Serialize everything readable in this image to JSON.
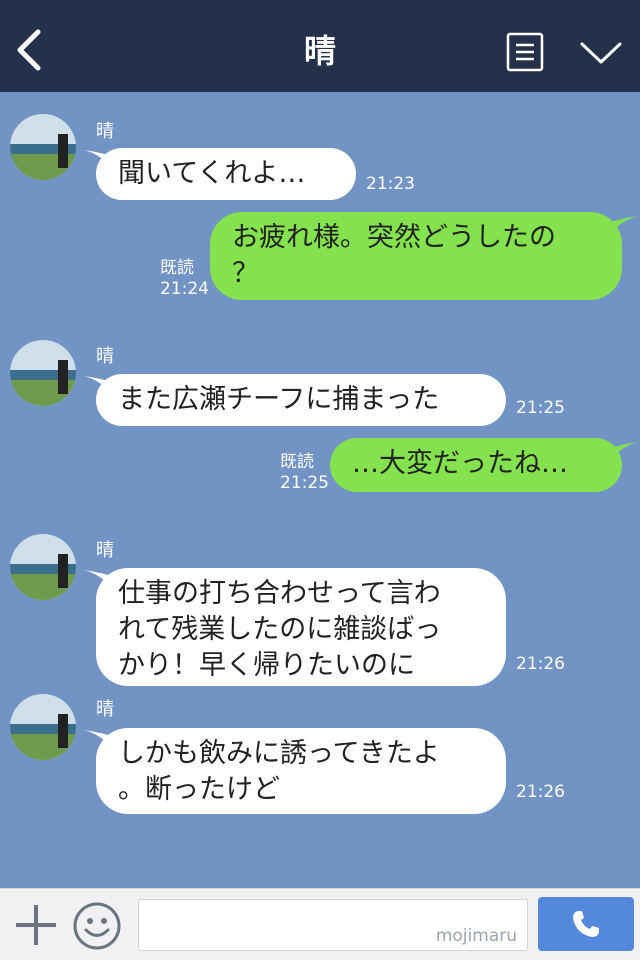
{
  "header": {
    "title": "晴",
    "icons": {
      "back": "chevron-left-icon",
      "menu": "list-icon",
      "collapse": "chevron-down-icon"
    }
  },
  "messages": [
    {
      "direction": "in",
      "sender": "晴",
      "text": "聞いてくれよ…",
      "time": "21:23"
    },
    {
      "direction": "out",
      "text": "お疲れ様。突然どうしたの\n？",
      "read": "既読",
      "time": "21:24"
    },
    {
      "direction": "in",
      "sender": "晴",
      "text": "また広瀬チーフに捕まった",
      "time": "21:25"
    },
    {
      "direction": "out",
      "text": "…大変だったね…",
      "read": "既読",
      "time": "21:25"
    },
    {
      "direction": "in",
      "sender": "晴",
      "text": "仕事の打ち合わせって言わ\nれて残業したのに雑談ばっ\nかり！早く帰りたいのに",
      "time": "21:26"
    },
    {
      "direction": "in",
      "sender": "晴",
      "text": "しかも飲みに誘ってきたよ\n。断ったけど",
      "time": "21:26"
    }
  ],
  "footer": {
    "input_value": "",
    "watermark": "mojimaru",
    "icons": {
      "add": "plus-icon",
      "emoji": "smiley-icon",
      "call": "phone-icon"
    }
  },
  "colors": {
    "header_bg": "#25304a",
    "chat_bg": "#7294c4",
    "incoming_bubble": "#ffffff",
    "outgoing_bubble": "#84e24f",
    "call_button": "#5488dd"
  }
}
